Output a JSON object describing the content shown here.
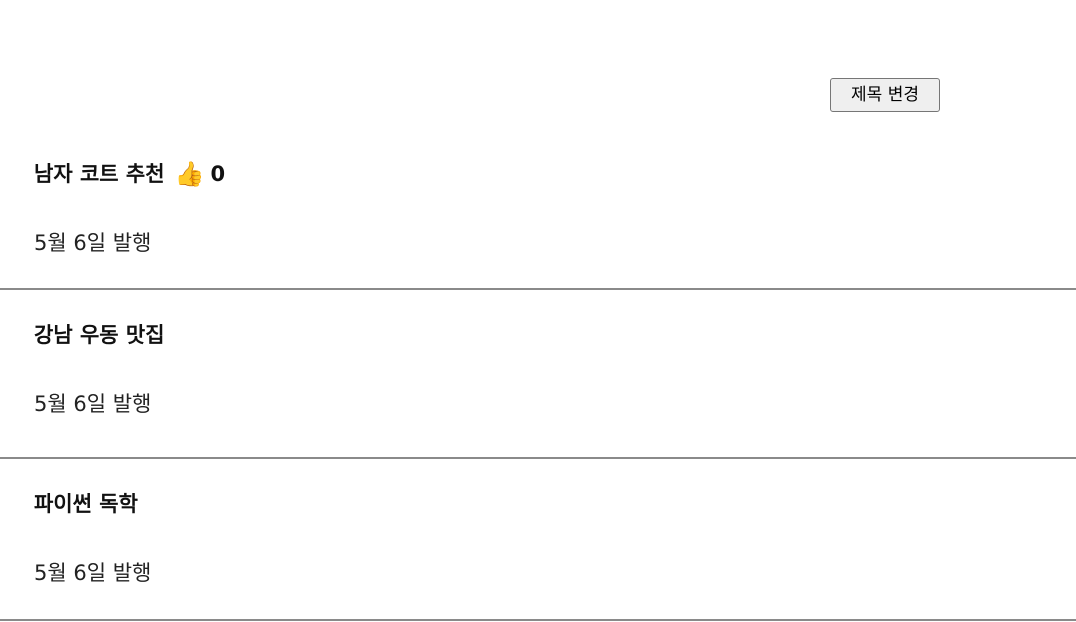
{
  "header": {
    "change_title_label": "제목 변경"
  },
  "posts": [
    {
      "title": "남자 코트 추천",
      "like_icon": "👍",
      "like_count": "0",
      "date": "5월 6일 발행"
    },
    {
      "title": "강남 우동 맛집",
      "date": "5월 6일 발행"
    },
    {
      "title": "파이썬 독학",
      "date": "5월 6일 발행"
    }
  ]
}
